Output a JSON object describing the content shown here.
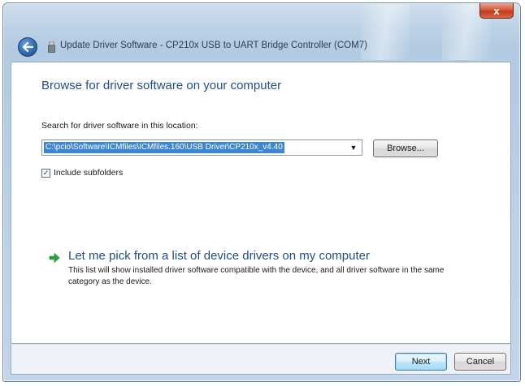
{
  "window": {
    "title": "Update Driver Software - CP210x USB to UART Bridge Controller (COM7)",
    "close_label": "x"
  },
  "page": {
    "heading": "Browse for driver software on your computer",
    "search_label": "Search for driver software in this location:",
    "path_value": "C:\\pcio\\Software\\ICMfiles\\ICMfiles.160\\USB Driver\\CP210x_v4.40",
    "browse_label": "Browse...",
    "include_subfolders_label": "Include subfolders",
    "include_subfolders_checked": true,
    "pick_title": "Let me pick from a list of device drivers on my computer",
    "pick_description": "This list will show installed driver software compatible with the device, and all driver software in the same category as the device."
  },
  "footer": {
    "next_label": "Next",
    "cancel_label": "Cancel"
  },
  "colors": {
    "heading_blue": "#1f4e8c",
    "selection_blue": "#3d86d6",
    "arrow_green": "#2fa33a",
    "close_red": "#c23a1c"
  },
  "icons": {
    "back": "back-arrow-icon",
    "title": "usb-device-icon",
    "pick": "green-arrow-icon",
    "combo": "chevron-down-icon"
  }
}
